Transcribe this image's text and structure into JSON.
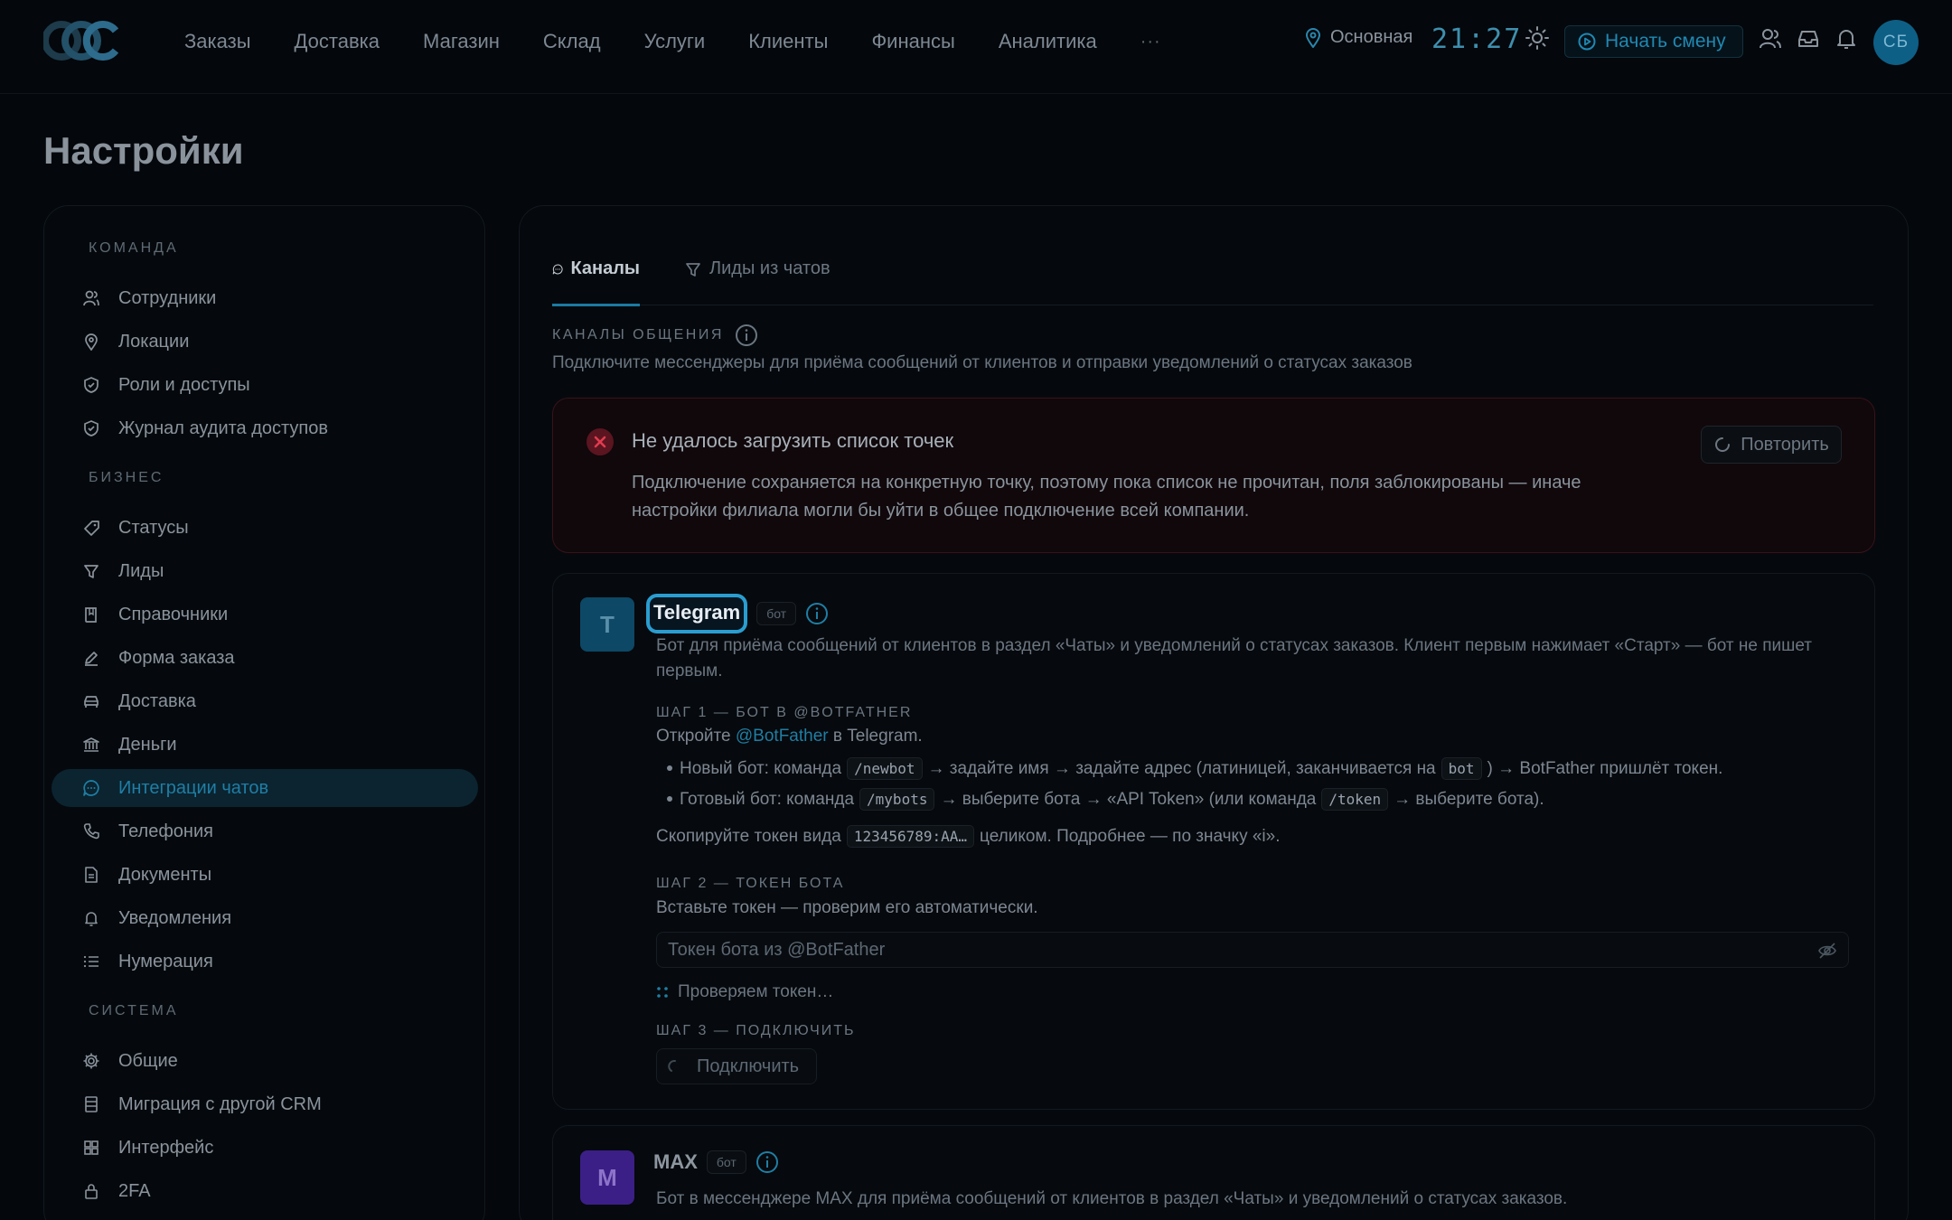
{
  "nav": {
    "items": [
      "Заказы",
      "Доставка",
      "Магазин",
      "Склад",
      "Услуги",
      "Клиенты",
      "Финансы",
      "Аналитика"
    ],
    "more": "···",
    "location": "Основная",
    "clock": "21:27",
    "shift_button": "Начать смену",
    "avatar_initials": "СБ",
    "accent_color": "#1f89b3"
  },
  "page": {
    "title": "Настройки"
  },
  "sidebar": {
    "sections": [
      {
        "title": "КОМАНДА",
        "items": [
          {
            "label": "Сотрудники",
            "icon": "users-icon"
          },
          {
            "label": "Локации",
            "icon": "location-pin-icon"
          },
          {
            "label": "Роли и доступы",
            "icon": "shield-check-icon"
          },
          {
            "label": "Журнал аудита доступов",
            "icon": "shield-audit-icon"
          }
        ]
      },
      {
        "title": "БИЗНЕС",
        "items": [
          {
            "label": "Статусы",
            "icon": "tag-icon"
          },
          {
            "label": "Лиды",
            "icon": "funnel-icon"
          },
          {
            "label": "Справочники",
            "icon": "book-icon"
          },
          {
            "label": "Форма заказа",
            "icon": "pen-icon"
          },
          {
            "label": "Доставка",
            "icon": "car-icon"
          },
          {
            "label": "Деньги",
            "icon": "bank-icon"
          },
          {
            "label": "Интеграции чатов",
            "icon": "chat-icon",
            "active": true
          },
          {
            "label": "Телефония",
            "icon": "phone-icon"
          },
          {
            "label": "Документы",
            "icon": "document-icon"
          },
          {
            "label": "Уведомления",
            "icon": "bell-icon"
          },
          {
            "label": "Нумерация",
            "icon": "list-icon"
          }
        ]
      },
      {
        "title": "СИСТЕМА",
        "items": [
          {
            "label": "Общие",
            "icon": "gear-icon"
          },
          {
            "label": "Миграция с другой CRM",
            "icon": "database-icon"
          },
          {
            "label": "Интерфейс",
            "icon": "grid-icon"
          },
          {
            "label": "2FA",
            "icon": "lock-icon"
          }
        ]
      }
    ]
  },
  "tabs": [
    {
      "label": "Каналы",
      "icon": "chat-icon",
      "active": true
    },
    {
      "label": "Лиды из чатов",
      "icon": "funnel-icon",
      "active": false
    }
  ],
  "channels_section": {
    "title": "КАНАЛЫ ОБЩЕНИЯ",
    "description": "Подключите мессенджеры для приёма сообщений от клиентов и отправки уведомлений о статусах заказов"
  },
  "error": {
    "title": "Не удалось загрузить список точек",
    "text": "Подключение сохраняется на конкретную точку, поэтому пока список не прочитан, поля заблокированы — иначе настройки филиала могли бы уйти в общее подключение всей компании.",
    "retry": "Повторить",
    "color": "#e23b4e"
  },
  "telegram": {
    "logo_letter": "T",
    "name": "Telegram",
    "badge": "бот",
    "description": "Бот для приёма сообщений от клиентов в раздел «Чаты» и уведомлений о статусах заказов. Клиент первым нажимает «Старт» — бот не пишет первым.",
    "step1_label": "ШАГ 1 — БОТ В @BOTFATHER",
    "step1_open_prefix": "Откройте",
    "step1_open_link": "@BotFather",
    "step1_open_suffix": "в Telegram.",
    "bullet1": {
      "prefix": "Новый бот: команда",
      "code": "/newbot",
      "middle": "→ задайте имя → задайте адрес (латиницей, заканчивается на",
      "code2": "bot",
      "suffix": ") → BotFather пришлёт токен."
    },
    "bullet2": {
      "prefix": "Готовый бот: команда",
      "code": "/mybots",
      "middle": "→ выберите бота → «API Token» (или команда",
      "code2": "/token",
      "suffix": "→ выберите бота)."
    },
    "copy_prefix": "Скопируйте токен вида",
    "copy_code": "123456789:AA…",
    "copy_suffix": "целиком. Подробнее — по значку «i».",
    "step2_label": "ШАГ 2 — ТОКЕН БОТА",
    "step2_text": "Вставьте токен — проверим его автоматически.",
    "token_placeholder": "Токен бота из @BotFather",
    "checking": "Проверяем токен…",
    "step3_label": "ШАГ 3 — ПОДКЛЮЧИТЬ",
    "connect": "Подключить"
  },
  "max": {
    "logo_letter": "M",
    "name": "MAX",
    "badge": "бот",
    "description": "Бот в мессенджере MAX для приёма сообщений от клиентов в раздел «Чаты» и уведомлений о статусах заказов."
  }
}
